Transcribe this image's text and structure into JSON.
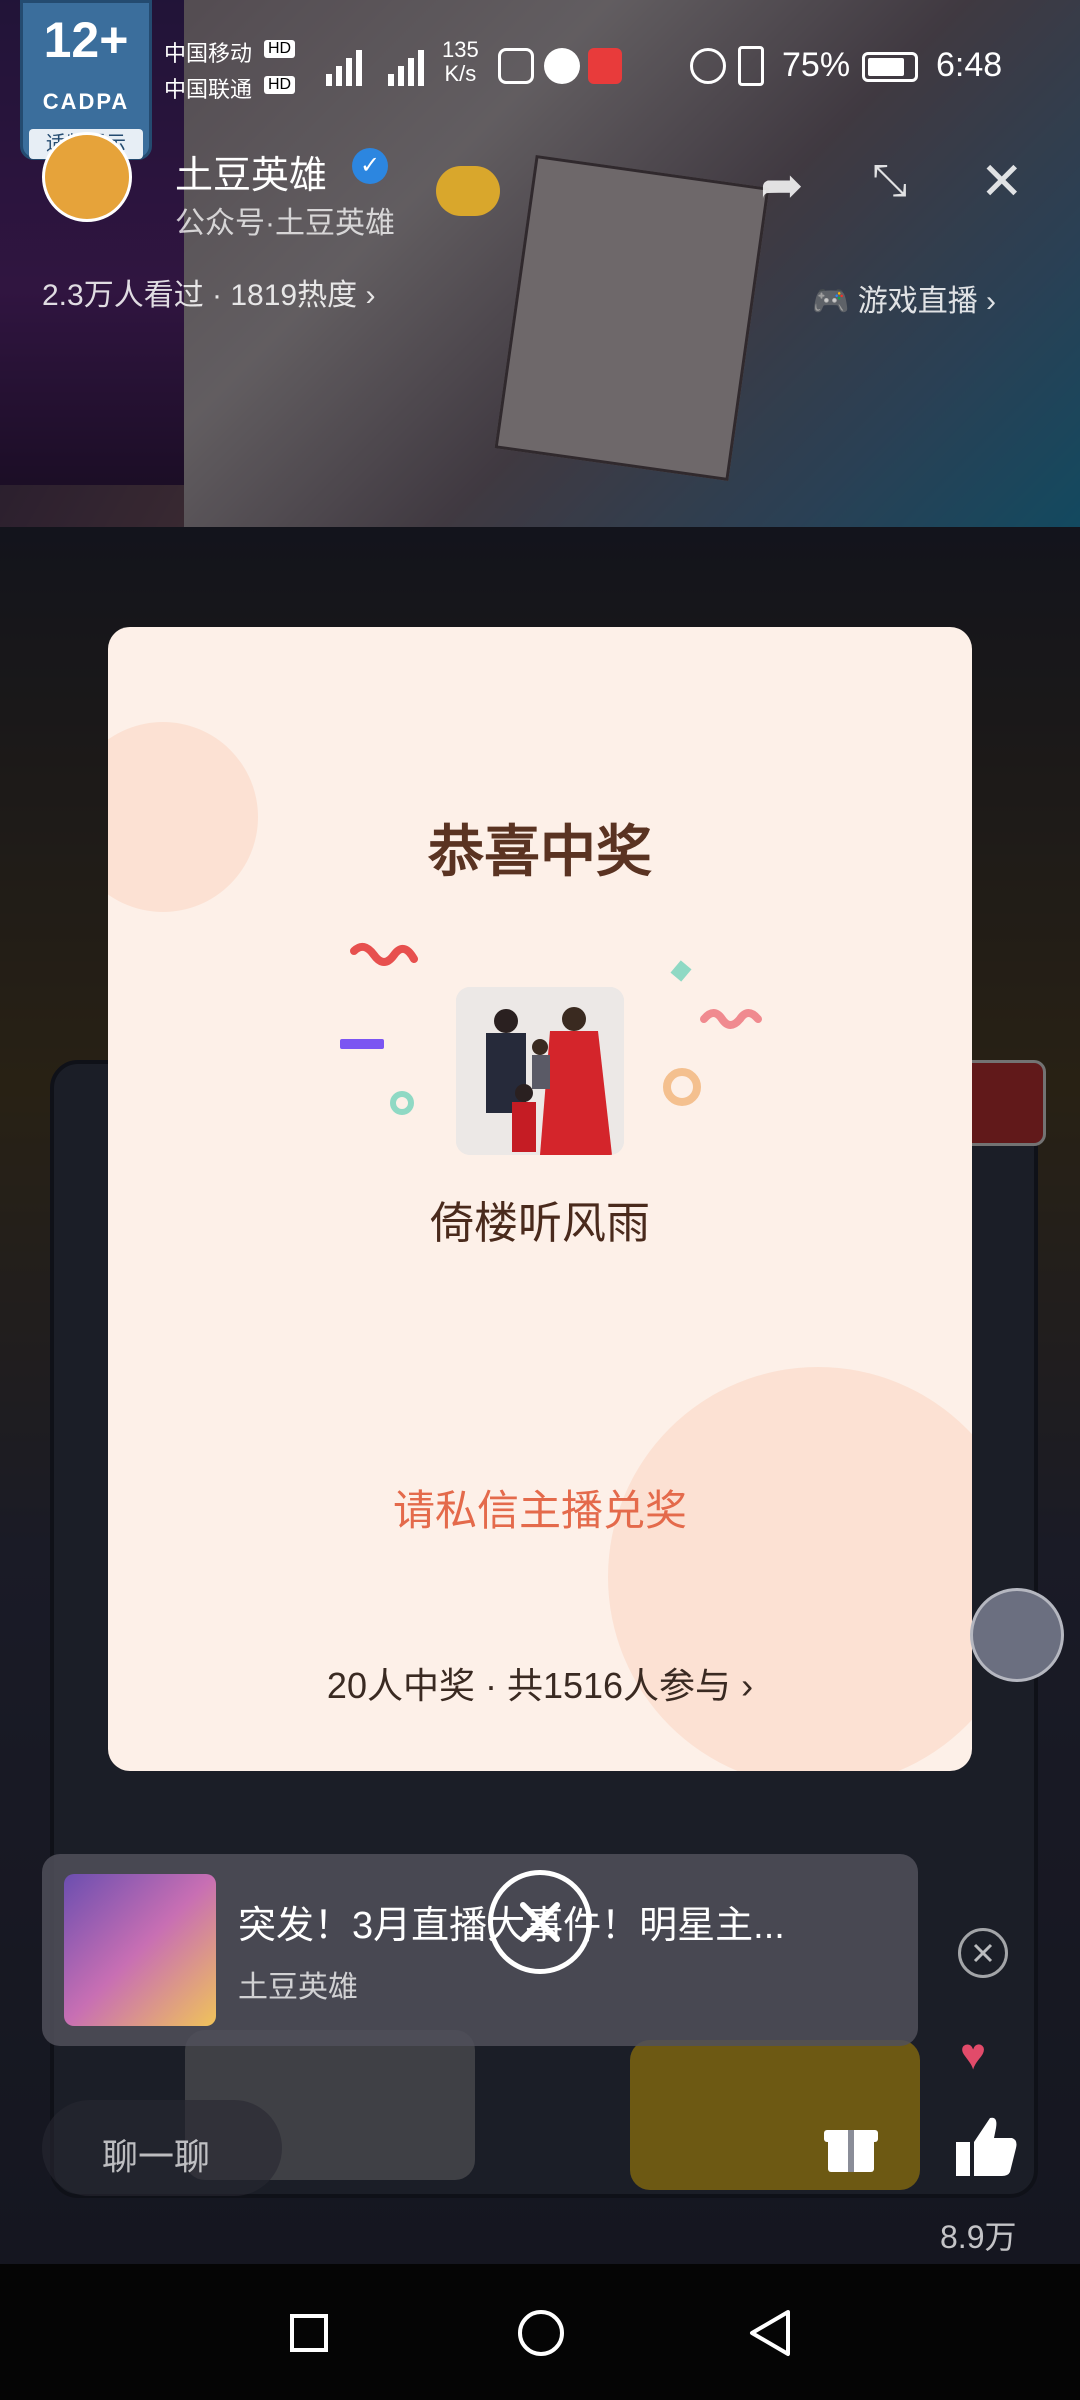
{
  "status_bar": {
    "age_rating": "12+",
    "rating_org": "CADPA",
    "rating_tip": "适龄提示",
    "carrier_1": "中国移动",
    "carrier_2": "中国联通",
    "hd_badge": "HD",
    "net_speed_value": "135",
    "net_speed_unit": "K/s",
    "battery": "75%",
    "time": "6:48"
  },
  "live_header": {
    "host_name": "土豆英雄",
    "host_sub": "公众号·土豆英雄",
    "viewers": "2.3万人看过 · 1819热度",
    "game_live_label": "游戏直播"
  },
  "modal": {
    "title": "恭喜中奖",
    "winner_name": "倚楼听风雨",
    "claim_text": "请私信主播兑奖",
    "stats_text": "20人中奖 · 共1516人参与"
  },
  "promo": {
    "title": "突发！3月直播大事件！明星主...",
    "subtitle": "土豆英雄"
  },
  "bottom": {
    "chat_label": "聊一聊",
    "like_count": "8.9万"
  },
  "colors": {
    "modal_bg": "#fdf0e8",
    "title_color": "#5a3322",
    "claim_color": "#e46a4b"
  }
}
